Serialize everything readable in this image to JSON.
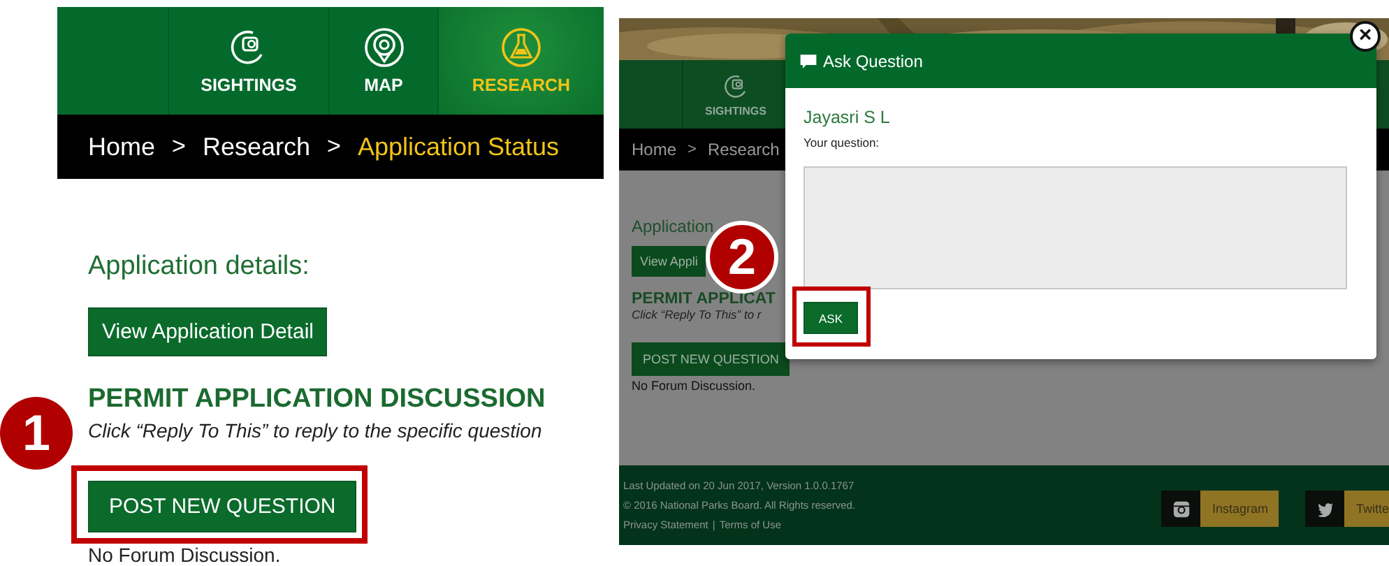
{
  "left_screen": {
    "nav_tabs": [
      {
        "kind": "camera",
        "label": "SIGHTINGS",
        "selected": false
      },
      {
        "kind": "pin",
        "label": "MAP",
        "selected": false
      },
      {
        "kind": "flask",
        "label": "RESEARCH",
        "selected": true
      }
    ],
    "breadcrumb": [
      {
        "kind": "link",
        "label": "Home",
        "current": false
      },
      {
        "kind": "separator",
        "label": ">"
      },
      {
        "kind": "link",
        "label": "Research",
        "current": false
      },
      {
        "kind": "separator",
        "label": ">"
      },
      {
        "kind": "link",
        "label": "Application Status",
        "current": true
      }
    ],
    "section_label": "Application details:",
    "detail_button": "View Application Detail",
    "heading": "PERMIT APPLICATION DISCUSSION",
    "hint": "Click “Reply To This” to reply to the specific question",
    "post_button": "POST NEW QUESTION",
    "empty_note": "No Forum Discussion.",
    "step_marker": "1"
  },
  "right_screen": {
    "nav_tabs": [
      {
        "kind": "camera",
        "label": "SIGHTINGS",
        "selected": false
      }
    ],
    "breadcrumb": [
      {
        "kind": "link",
        "label": "Home",
        "current": false
      },
      {
        "kind": "separator",
        "label": ">"
      },
      {
        "kind": "link",
        "label": "Research",
        "current": false
      }
    ],
    "section_label": "Application",
    "detail_button": "View Appli",
    "heading": "PERMIT APPLICAT",
    "hint": "Click “Reply To This” to r",
    "post_button": "POST NEW QUESTION",
    "empty_note": "No Forum Discussion.",
    "footer": {
      "lines": [
        "Last Updated on 20 Jun 2017, Version 1.0.0.1767",
        "© 2016 National Parks Board. All Rights reserved."
      ],
      "links": [
        "Privacy Statement",
        "Terms of Use"
      ],
      "link_separator": "|",
      "social": [
        {
          "kind": "instagram",
          "label": "Instagram"
        },
        {
          "kind": "twitter",
          "label": "Twitte"
        }
      ]
    },
    "dialog": {
      "title": "Ask Question",
      "close": "×",
      "user": "Jayasri S L",
      "field_label": "Your question:",
      "submit": "ASK"
    },
    "step_marker": "2"
  }
}
